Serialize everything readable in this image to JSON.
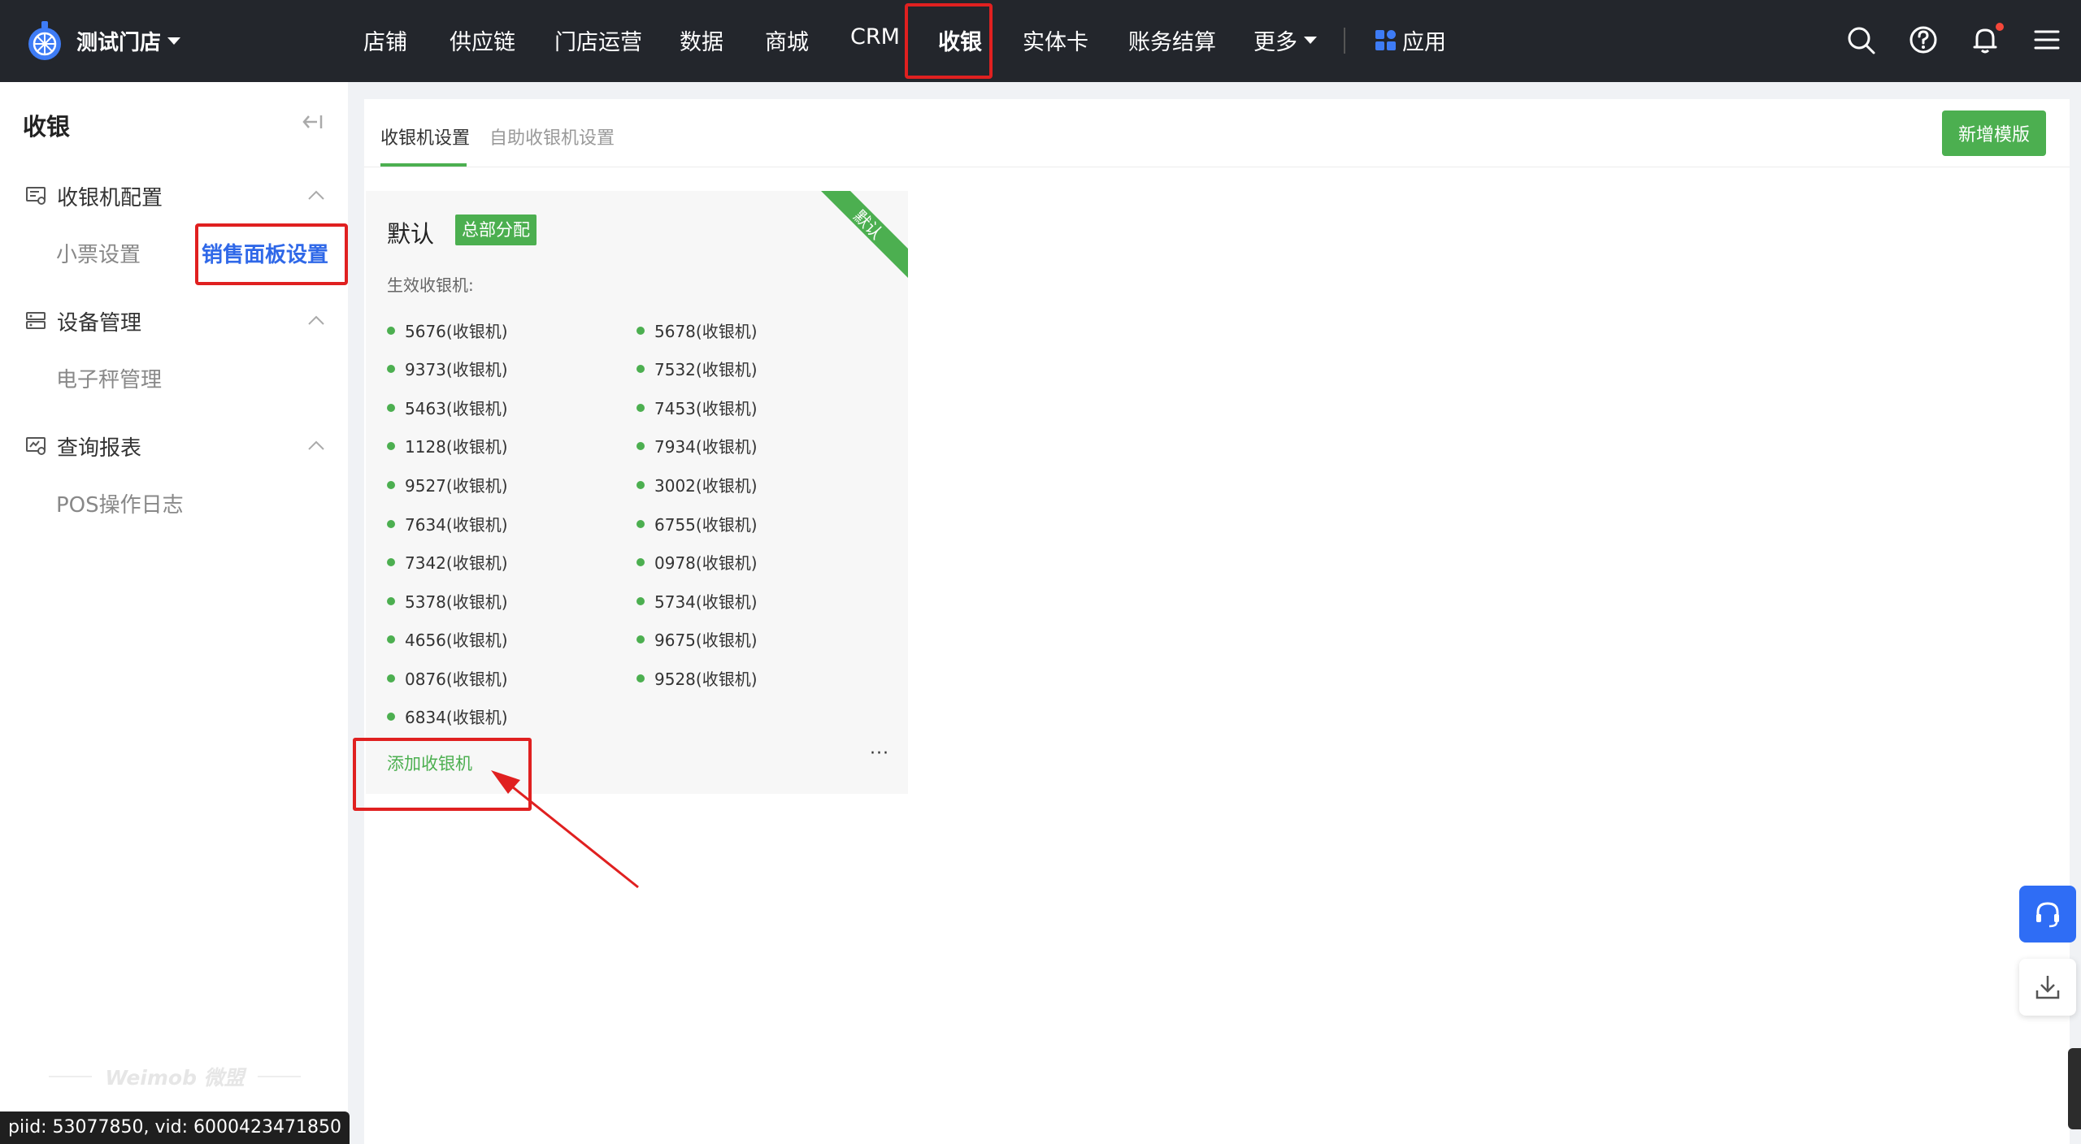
{
  "header": {
    "store_name": "测试门店",
    "nav": [
      "店铺",
      "供应链",
      "门店运营",
      "数据",
      "商城",
      "CRM",
      "收银",
      "实体卡",
      "账务结算",
      "更多",
      "应用"
    ],
    "active_nav": "收银",
    "icons": [
      "search-icon",
      "help-icon",
      "bell-icon",
      "menu-icon"
    ]
  },
  "sidebar": {
    "title": "收银",
    "groups": [
      {
        "label": "收银机配置",
        "icon": "cashier-config-icon",
        "items": [
          "小票设置",
          "销售面板设置"
        ]
      },
      {
        "label": "设备管理",
        "icon": "device-icon",
        "items": [
          "电子秤管理"
        ]
      },
      {
        "label": "查询报表",
        "icon": "report-icon",
        "items": [
          "POS操作日志"
        ]
      }
    ],
    "active_item": "销售面板设置",
    "watermark": "Weimob 微盟"
  },
  "main": {
    "tabs": [
      "收银机设置",
      "自助收银机设置"
    ],
    "active_tab": "收银机设置",
    "add_template_button": "新增模版",
    "card": {
      "name": "默认",
      "badge": "总部分配",
      "ribbon": "默认",
      "effective_label": "生效收银机:",
      "left_col": [
        "5676(收银机)",
        "9373(收银机)",
        "5463(收银机)",
        "1128(收银机)",
        "9527(收银机)",
        "7634(收银机)",
        "7342(收银机)",
        "5378(收银机)",
        "4656(收银机)",
        "0876(收银机)",
        "6834(收银机)"
      ],
      "right_col": [
        "5678(收银机)",
        "7532(收银机)",
        "7453(收银机)",
        "7934(收银机)",
        "3002(收银机)",
        "6755(收银机)",
        "0978(收银机)",
        "5734(收银机)",
        "9675(收银机)",
        "9528(收银机)"
      ],
      "add_link": "添加收银机",
      "more": "···"
    }
  },
  "footer": {
    "piid": "piid: 53077850, vid: 6000423471850"
  },
  "colors": {
    "topbar": "#23262c",
    "primary_green": "#4caf50",
    "active_blue": "#2f68e8",
    "annotation_red": "#e02020"
  }
}
